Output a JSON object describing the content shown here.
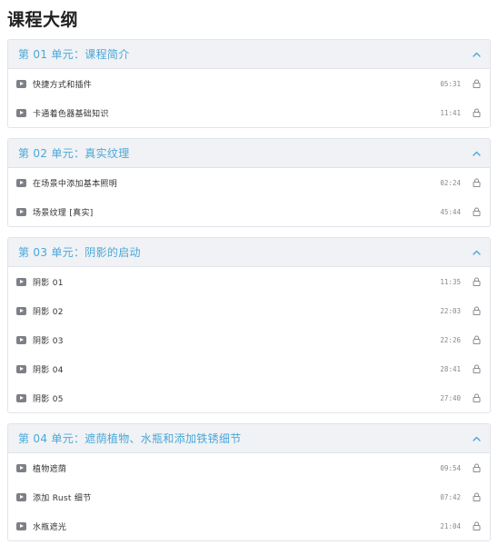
{
  "page": {
    "title": "课程大纲"
  },
  "colors": {
    "accent": "#4aa8d8",
    "header_bg": "#f0f2f5",
    "border": "#e1e4ea"
  },
  "icons": {
    "play": "play-icon",
    "lock": "lock-icon",
    "collapse": "chevron-up-icon"
  },
  "sections": [
    {
      "title": "第 01 单元：课程简介",
      "lessons": [
        {
          "title": "快捷方式和插件",
          "duration": "05:31"
        },
        {
          "title": "卡通着色器基础知识",
          "duration": "11:41"
        }
      ]
    },
    {
      "title": "第 02 单元：真实纹理",
      "lessons": [
        {
          "title": "在场景中添加基本照明",
          "duration": "02:24"
        },
        {
          "title": "场景纹理 [真实]",
          "duration": "45:44"
        }
      ]
    },
    {
      "title": "第 03 单元：阴影的启动",
      "lessons": [
        {
          "title": "阴影 01",
          "duration": "11:35"
        },
        {
          "title": "阴影 02",
          "duration": "22:03"
        },
        {
          "title": "阴影 03",
          "duration": "22:26"
        },
        {
          "title": "阴影 04",
          "duration": "28:41"
        },
        {
          "title": "阴影 05",
          "duration": "27:40"
        }
      ]
    },
    {
      "title": "第 04 单元：遮荫植物、水瓶和添加铁锈细节",
      "lessons": [
        {
          "title": "植物遮荫",
          "duration": "09:54"
        },
        {
          "title": "添加 Rust 细节",
          "duration": "07:42"
        },
        {
          "title": "水瓶遮光",
          "duration": "21:04"
        }
      ]
    }
  ]
}
